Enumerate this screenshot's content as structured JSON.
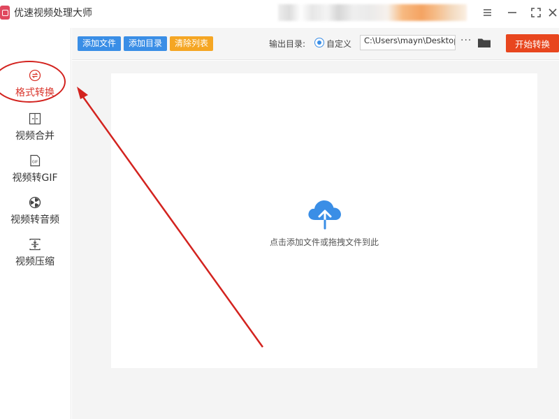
{
  "app": {
    "title": "优速视频处理大师"
  },
  "window_controls": {
    "menu_icon": "menu-icon",
    "min_icon": "minimize-icon",
    "max_icon": "maximize-icon",
    "close_icon": "close-icon"
  },
  "sidebar": {
    "items": [
      {
        "label": "格式转换",
        "icon": "convert-icon",
        "active": true
      },
      {
        "label": "视频合并",
        "icon": "merge-icon",
        "active": false
      },
      {
        "label": "视频转GIF",
        "icon": "gif-icon",
        "active": false
      },
      {
        "label": "视频转音频",
        "icon": "audio-icon",
        "active": false
      },
      {
        "label": "视频压缩",
        "icon": "compress-icon",
        "active": false
      }
    ]
  },
  "toolbar": {
    "add_file_label": "添加文件",
    "add_dir_label": "添加目录",
    "clear_list_label": "清除列表",
    "output_dir_label": "输出目录:",
    "custom_radio_label": "自定义",
    "output_path_value": "C:\\Users\\mayn\\Desktop",
    "more_label": "···",
    "folder_icon": "folder-icon",
    "start_label": "开始转换"
  },
  "main": {
    "drop_text": "点击添加文件或拖拽文件到此",
    "upload_icon": "cloud-upload-icon"
  },
  "colors": {
    "accent_blue": "#3a8ee6",
    "clear_orange": "#f5a623",
    "start_red": "#e8461e",
    "active_red": "#d9342b",
    "annotation_red": "#d3231f"
  }
}
